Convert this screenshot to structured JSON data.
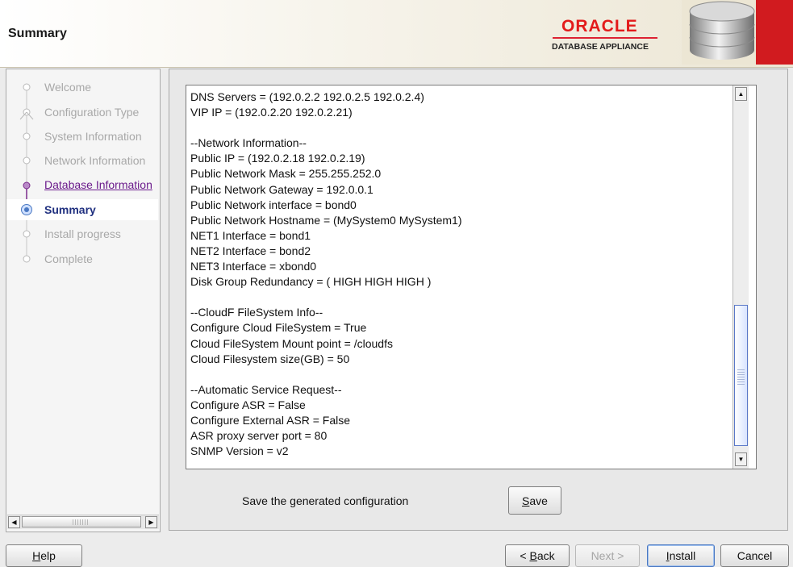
{
  "header": {
    "title": "Summary",
    "logo_brand": "ORACLE",
    "logo_sub": "DATABASE APPLIANCE",
    "brand_color": "#e31b1b"
  },
  "steps": [
    {
      "label": "Welcome",
      "state": "disabled"
    },
    {
      "label": "Configuration Type",
      "state": "disabled"
    },
    {
      "label": "System Information",
      "state": "disabled"
    },
    {
      "label": "Network Information",
      "state": "disabled"
    },
    {
      "label": "Database Information",
      "state": "link"
    },
    {
      "label": "Summary",
      "state": "current"
    },
    {
      "label": "Install progress",
      "state": "disabled"
    },
    {
      "label": "Complete",
      "state": "disabled"
    }
  ],
  "summary": {
    "lines": [
      "DNS Servers = (192.0.2.2 192.0.2.5 192.0.2.4)",
      "VIP IP = (192.0.2.20 192.0.2.21)",
      "",
      "--Network Information--",
      "Public IP = (192.0.2.18 192.0.2.19)",
      "Public Network Mask = 255.255.252.0",
      "Public Network Gateway = 192.0.0.1",
      "Public Network interface = bond0",
      "Public Network Hostname = (MySystem0 MySystem1)",
      "NET1 Interface = bond1",
      "NET2 Interface = bond2",
      "NET3 Interface = xbond0",
      "Disk Group Redundancy = ( HIGH HIGH HIGH )",
      "",
      "--CloudF FileSystem Info--",
      "Configure Cloud FileSystem = True",
      "Cloud FileSystem Mount point = /cloudfs",
      "Cloud Filesystem size(GB) = 50",
      "",
      "--Automatic Service Request--",
      "Configure ASR = False",
      "Configure External ASR = False",
      "ASR proxy server port = 80",
      "SNMP Version = v2"
    ]
  },
  "save_section": {
    "label": "Save the generated configuration",
    "button_mnemonic": "S",
    "button_rest": "ave"
  },
  "buttons": {
    "help_mnemonic": "H",
    "help_rest": "elp",
    "back_prefix": "< ",
    "back_mnemonic": "B",
    "back_rest": "ack",
    "next_label": "Next >",
    "install_mnemonic": "I",
    "install_rest": "nstall",
    "cancel_label": "Cancel"
  },
  "colors": {
    "accent_blue": "#4a78c2",
    "link_purple": "#6b1b8c",
    "current_step_text": "#1f2f7f"
  }
}
